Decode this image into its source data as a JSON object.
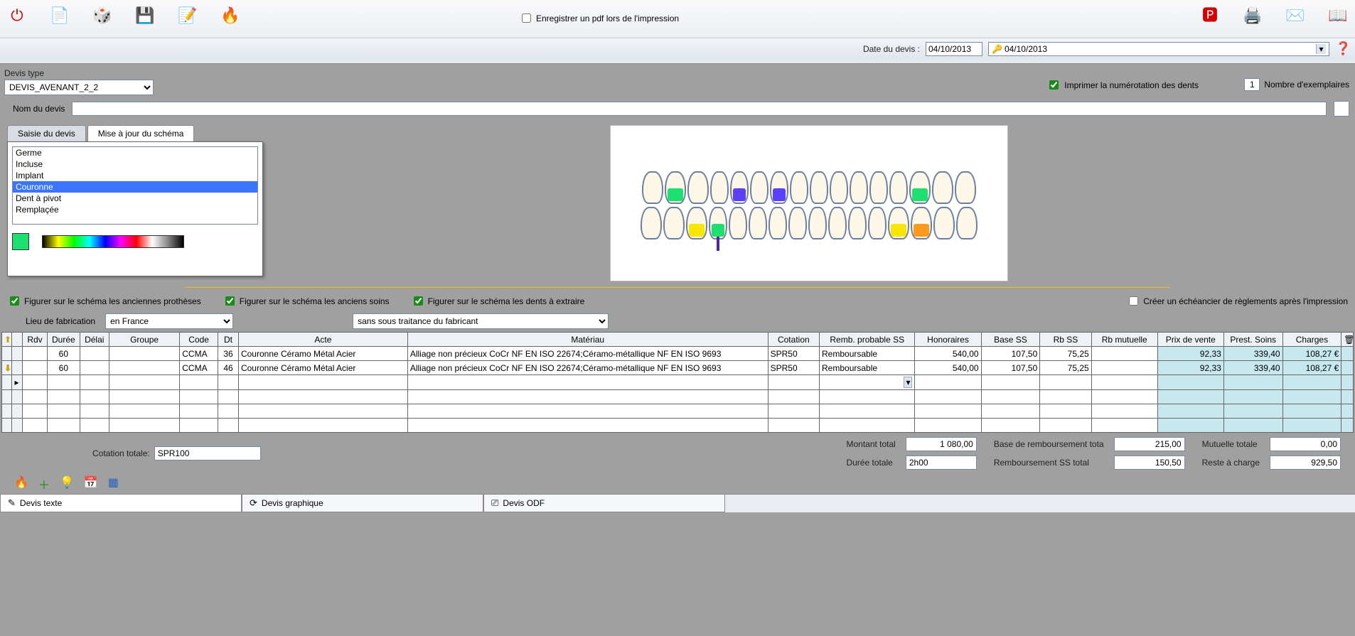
{
  "toolbar": {
    "pdf_checkbox_label": "Enregistrer un pdf lors de l'impression",
    "pdf_checkbox_checked": false,
    "date_label": "Date du devis :",
    "date_value": "04/10/2013",
    "date_display_value": "04/10/2013"
  },
  "devis": {
    "type_label": "Devis type",
    "type_value": "DEVIS_AVENANT_2_2",
    "print_num_label": "Imprimer la numérotation des dents",
    "print_num_checked": true,
    "copies_value": "1",
    "copies_label": "Nombre d'exemplaires",
    "nom_label": "Nom du devis",
    "nom_value": ""
  },
  "tabs": {
    "tab1": "Saisie du devis",
    "tab2": "Mise à jour du schéma"
  },
  "tooth_states": {
    "items": [
      "Germe",
      "Incluse",
      "Implant",
      "Couronne",
      "Dent à pivot",
      "Remplaçée"
    ],
    "selected": "Couronne",
    "swatch_color": "#1ee070"
  },
  "opts": {
    "o1": "Figurer sur le schéma les anciennes prothèses",
    "o2": "Figurer sur le schéma les anciens soins",
    "o3": "Figurer sur le schéma les dents à extraire",
    "o4": "Créer un échéancier de règlements après l'impression"
  },
  "fabric": {
    "lieu_label": "Lieu de fabrication",
    "lieu_value": "en France",
    "sous_value": "sans sous traitance du fabricant"
  },
  "grid": {
    "headers": {
      "rdv": "Rdv",
      "duree": "Durée",
      "delai": "Délai",
      "groupe": "Groupe",
      "code": "Code",
      "dt": "Dt",
      "acte": "Acte",
      "materiau": "Matériau",
      "cotation": "Cotation",
      "rembss": "Remb. probable SS",
      "honor": "Honoraires",
      "basess": "Base SS",
      "rbss": "Rb SS",
      "rbmut": "Rb mutuelle",
      "prix": "Prix de vente",
      "prest": "Prest. Soins",
      "charges": "Charges"
    },
    "rows": [
      {
        "rdv": "",
        "duree": "60",
        "delai": "",
        "groupe": "",
        "code": "CCMA",
        "dt": "36",
        "acte": "Couronne Céramo Métal Acier",
        "materiau": "Alliage non précieux CoCr NF EN ISO 22674;Céramo-métallique NF EN ISO 9693",
        "cotation": "SPR50",
        "rembss": "Remboursable",
        "honor": "540,00",
        "basess": "107,50",
        "rbss": "75,25",
        "rbmut": "",
        "prix": "92,33",
        "prest": "339,40",
        "charges": "108,27 €"
      },
      {
        "rdv": "",
        "duree": "60",
        "delai": "",
        "groupe": "",
        "code": "CCMA",
        "dt": "46",
        "acte": "Couronne Céramo Métal Acier",
        "materiau": "Alliage non précieux CoCr NF EN ISO 22674;Céramo-métallique NF EN ISO 9693",
        "cotation": "SPR50",
        "rembss": "Remboursable",
        "honor": "540,00",
        "basess": "107,50",
        "rbss": "75,25",
        "rbmut": "",
        "prix": "92,33",
        "prest": "339,40",
        "charges": "108,27 €"
      }
    ]
  },
  "totals": {
    "cot_label": "Cotation totale:",
    "cot_value": "SPR100",
    "montant_label": "Montant total",
    "montant_value": "1 080,00",
    "base_label": "Base de remboursement tota",
    "base_value": "215,00",
    "mut_label": "Mutuelle totale",
    "mut_value": "0,00",
    "duree_label": "Durée totale",
    "duree_value": "2h00",
    "rss_label": "Remboursement SS total",
    "rss_value": "150,50",
    "reste_label": "Reste à charge",
    "reste_value": "929,50"
  },
  "bottom": {
    "t1": "Devis texte",
    "t2": "Devis graphique",
    "t3": "Devis ODF"
  }
}
